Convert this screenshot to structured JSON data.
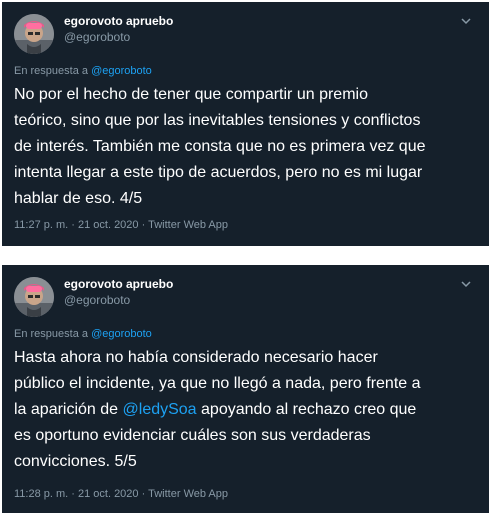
{
  "icons": {
    "avatar": "avatar-photo",
    "chevron": "chevron-down-icon"
  },
  "colors": {
    "background": "#15202b",
    "text": "#ffffff",
    "secondary": "#8899a6",
    "link": "#1da1f2"
  },
  "tweets": [
    {
      "display_name": "egorovoto apruebo",
      "handle": "@egoroboto",
      "reply_prefix": "En respuesta a ",
      "reply_to": "@egoroboto",
      "text_parts": [
        "No por el hecho de tener que compartir un premio\nteórico, sino que por las inevitables tensiones y conflictos\nde interés. También me consta que no es primera vez que\nintenta llegar a este tipo de acuerdos, pero no es mi lugar\nhablar de eso. 4/5"
      ],
      "meta": "11:27 p. m. · 21 oct. 2020 · Twitter Web App"
    },
    {
      "display_name": "egorovoto apruebo",
      "handle": "@egoroboto",
      "reply_prefix": "En respuesta a ",
      "reply_to": "@egoroboto",
      "text_before": "Hasta ahora no había considerado necesario hacer\npúblico el incidente, ya que no llegó a nada, pero frente a\nla aparición de ",
      "mention": "@ledySoa",
      "text_after": " apoyando al rechazo creo que\nes oportuno evidenciar cuáles son sus verdaderas\nconvicciones. 5/5",
      "meta": "11:28 p. m. · 21 oct. 2020 · Twitter Web App"
    }
  ]
}
